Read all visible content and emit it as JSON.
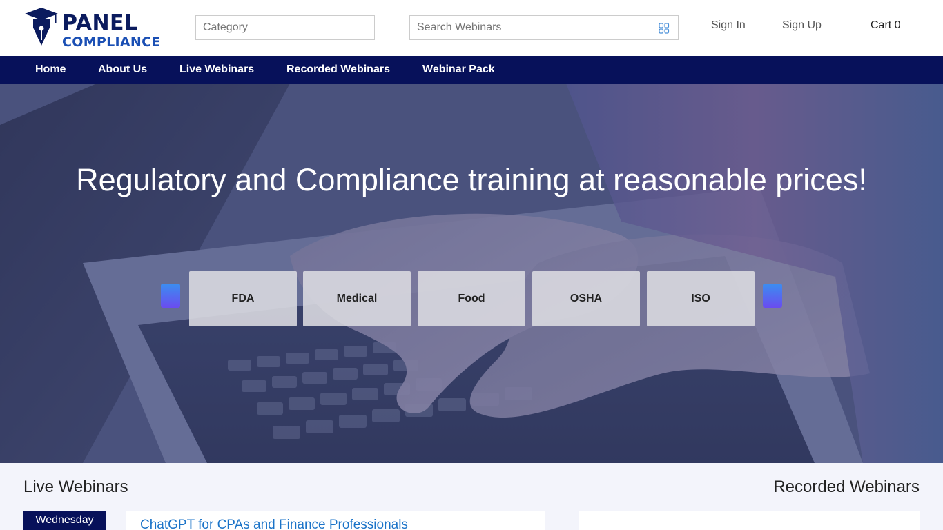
{
  "brand": {
    "line1": "PANEL",
    "line2": "COMPLIANCE"
  },
  "header": {
    "category_placeholder": "Category",
    "search_placeholder": "Search Webinars",
    "sign_in": "Sign In",
    "sign_up": "Sign Up",
    "cart_label": "Cart 0"
  },
  "nav": {
    "items": [
      "Home",
      "About Us",
      "Live Webinars",
      "Recorded Webinars",
      "Webinar Pack"
    ]
  },
  "hero": {
    "title": "Regulatory and Compliance training at reasonable prices!",
    "categories": [
      "FDA",
      "Medical",
      "Food",
      "OSHA",
      "ISO"
    ]
  },
  "live": {
    "title": "Live Webinars",
    "day": "Wednesday",
    "first_webinar": "ChatGPT for CPAs and Finance Professionals"
  },
  "recorded": {
    "title": "Recorded Webinars"
  },
  "colors": {
    "nav_bg": "#07115a",
    "brand": "#0b1b5e",
    "link": "#1a73c8",
    "section_bg": "#f3f4fb"
  }
}
